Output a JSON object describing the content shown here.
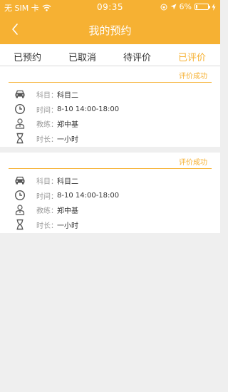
{
  "status_bar": {
    "carrier": "无 SIM 卡",
    "time": "09:35",
    "battery": "6%"
  },
  "nav": {
    "title": "我的预约"
  },
  "tabs": [
    {
      "label": "已预约"
    },
    {
      "label": "已取消"
    },
    {
      "label": "待评价"
    },
    {
      "label": "已评价"
    }
  ],
  "active_tab": "已评价",
  "colors": {
    "accent": "#f6b133",
    "background": "#efefef"
  },
  "cards": [
    {
      "status": "评价成功",
      "subject_label": "科目：",
      "subject": "科目二",
      "time_label": "时间：",
      "time": "8-10  14:00-18:00",
      "coach_label": "教练：",
      "coach": "郑中基",
      "duration_label": "时长：",
      "duration": "一小时"
    },
    {
      "status": "评价成功",
      "subject_label": "科目：",
      "subject": "科目二",
      "time_label": "时间：",
      "time": "8-10  14:00-18:00",
      "coach_label": "教练：",
      "coach": "郑中基",
      "duration_label": "时长：",
      "duration": "一小时"
    }
  ]
}
